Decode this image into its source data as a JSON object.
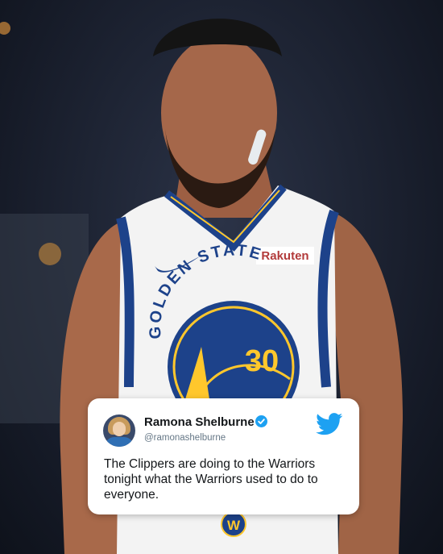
{
  "jersey": {
    "sponsor": "Rakuten",
    "team_arc": "GOLDEN STATE",
    "number": "30"
  },
  "tweet": {
    "display_name": "Ramona Shelburne",
    "handle": "@ramonashelburne",
    "text": "The Clippers are doing to the Warriors tonight what the Warriors used to do to everyone."
  },
  "colors": {
    "warriors_blue": "#1d428a",
    "warriors_gold": "#ffc72c",
    "twitter_blue": "#1da1f2"
  }
}
